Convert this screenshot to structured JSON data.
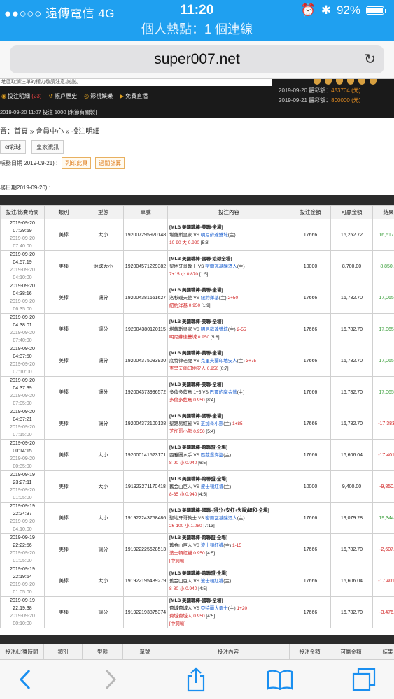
{
  "status": {
    "carrier": "●●○○○ 遠傳電信  4G",
    "time": "11:20",
    "battery": "92%",
    "hotspot": "個人熱點：1 個連線"
  },
  "browser": {
    "url": "super007.net"
  },
  "site": {
    "notice": "地區取消注單的權力敬請注意,謝謝。",
    "menu": [
      {
        "icon": "bet-list-icon",
        "label": "投注明細",
        "badge": "(23)"
      },
      {
        "icon": "history-icon",
        "label": "帳戶歷史"
      },
      {
        "icon": "video-icon",
        "label": "影視娛樂"
      },
      {
        "icon": "live-icon",
        "label": "免費直播"
      }
    ],
    "last_bet": "2019-09-20 11:07 投注 1000 [米節有關製]",
    "draws": [
      {
        "date": "2019-09-20",
        "label": "體彩額：",
        "amount": "453704 (元)"
      },
      {
        "date": "2019-09-21",
        "label": "體彩額：",
        "amount": "800000 (元)"
      }
    ],
    "breadcrumb": "置：首頁 » 會員中心 » 投注明細",
    "tabs": [
      "er彩球",
      "皇家視訊"
    ],
    "filter_label": "帳務日期  2019-09-21) :",
    "filter_buttons": [
      "列印此頁",
      "過關計算"
    ],
    "biz_date": "務日期2019-09-20) :"
  },
  "table": {
    "headers": [
      "投注/比賽時間",
      "類別",
      "型態",
      "單號",
      "投注內容",
      "投注金額",
      "可贏金額",
      "結果"
    ],
    "rows": [
      {
        "t1": "2019-09-20",
        "t2": "07:29:59",
        "t3": "2019-09-20",
        "t4": "07:40:00",
        "cat": "美棒",
        "type": "大小",
        "id": "192007295920148",
        "league": "[MLB 美國職棒-美聯-全場]",
        "home": "堪薩斯皇家",
        "vs": "VS",
        "away": "明尼蘇達雙城",
        "side": "(主)",
        "line": "",
        "pick": "10-90 大 0.920",
        "score": "[5:8]",
        "note": "",
        "amount": "17666",
        "win": "16,252.72",
        "result": "16,517.7",
        "res_class": "win"
      },
      {
        "t1": "2019-09-20",
        "t2": "04:57:19",
        "t3": "2019-09-20",
        "t4": "04:10:00",
        "cat": "美棒",
        "type": "滾球大小",
        "id": "192004571229382",
        "league": "[MLB 美國職棒-國聯-滾球全場]",
        "home": "聖地牙哥教士",
        "vs": "VS",
        "away": "密爾瓦基釀酒人",
        "side": "(主)",
        "line": "",
        "pick": "7+15 小 0.870",
        "score": "[1:5]",
        "note": "",
        "amount": "10000",
        "win": "8,700.00",
        "result": "8,850.0",
        "res_class": "win"
      },
      {
        "t1": "2019-09-20",
        "t2": "04:38:16",
        "t3": "2019-09-20",
        "t4": "06:35:00",
        "cat": "美棒",
        "type": "讓分",
        "id": "192004381651627",
        "league": "[MLB 美國職棒-美聯-全場]",
        "home": "洛杉磯天使",
        "vs": "VS",
        "away": "紐約洋基",
        "side": "(主)",
        "line": "2+50",
        "pick": "紐約洋基 0.950",
        "score": "[1:9]",
        "note": "",
        "amount": "17666",
        "win": "16,782.70",
        "result": "17,065.3",
        "res_class": "win"
      },
      {
        "t1": "2019-09-20",
        "t2": "04:38:01",
        "t3": "2019-09-20",
        "t4": "07:40:00",
        "cat": "美棒",
        "type": "讓分",
        "id": "192004380120115",
        "league": "[MLB 美國職棒-美聯-全場]",
        "home": "堪薩斯皇家",
        "vs": "VS",
        "away": "明尼蘇達雙城",
        "side": "(主)",
        "line": "2-55",
        "pick": "明尼蘇達雙城 0.950",
        "score": "[5:8]",
        "note": "",
        "amount": "17666",
        "win": "16,782.70",
        "result": "17,065.3",
        "res_class": "win"
      },
      {
        "t1": "2019-09-20",
        "t2": "04:37:50",
        "t3": "2019-09-20",
        "t4": "07:10:00",
        "cat": "美棒",
        "type": "讓分",
        "id": "192004375083930",
        "league": "[MLB 美國職棒-美聯-全場]",
        "home": "底特律老虎",
        "vs": "VS",
        "away": "克里夫蘭印地安人",
        "side": "(主)",
        "line": "3+75",
        "pick": "克里夫蘭印地安人 0.950",
        "score": "[0:7]",
        "note": "",
        "amount": "17666",
        "win": "16,782.70",
        "result": "17,065.3",
        "res_class": "win"
      },
      {
        "t1": "2019-09-20",
        "t2": "04:37:39",
        "t3": "2019-09-20",
        "t4": "07:05:00",
        "cat": "美棒",
        "type": "讓分",
        "id": "192004373996572",
        "league": "[MLB 美國職棒-美聯-全場]",
        "home": "多倫多藍鳥",
        "vs": "1+5 VS",
        "away": "巴爾的摩金鶯",
        "side": "(主)",
        "line": "",
        "pick": "多倫多藍鳥 0.950",
        "score": "[8:4]",
        "note": "",
        "amount": "17666",
        "win": "16,782.70",
        "result": "17,065.3",
        "res_class": "win"
      },
      {
        "t1": "2019-09-20",
        "t2": "04:37:21",
        "t3": "2019-09-20",
        "t4": "07:15:00",
        "cat": "美棒",
        "type": "讓分",
        "id": "192004372100138",
        "league": "[MLB 美國職棒-國聯-全場]",
        "home": "聖路易紅雀",
        "vs": "VS",
        "away": "芝加哥小熊",
        "side": "(主)",
        "line": "1+85",
        "pick": "芝加哥小熊 0.950",
        "score": "[5:4]",
        "note": "",
        "amount": "17666",
        "win": "16,782.70",
        "result": "-17,383.3",
        "res_class": "lose"
      },
      {
        "t1": "2019-09-20",
        "t2": "00:14:15",
        "t3": "2019-09-20",
        "t4": "00:35:00",
        "cat": "美棒",
        "type": "大小",
        "id": "192000141523171",
        "league": "[MLB 美國職棒-跨聯盟-全場]",
        "home": "西雅圖水手",
        "vs": "VS",
        "away": "匹茲堡海盜",
        "side": "(主)",
        "line": "",
        "pick": "8-90 小 0.940",
        "score": "[6:5]",
        "note": "",
        "amount": "17666",
        "win": "16,606.04",
        "result": "-17,401.0",
        "res_class": "lose"
      },
      {
        "t1": "2019-09-19",
        "t2": "23:27:11",
        "t3": "2019-09-20",
        "t4": "01:05:00",
        "cat": "美棒",
        "type": "大小",
        "id": "191923271170418",
        "league": "[MLB 美國職棒-跨聯盟-全場]",
        "home": "舊金山巨人",
        "vs": "VS",
        "away": "波士頓紅襪",
        "side": "(主)",
        "line": "",
        "pick": "8-35 小 0.940",
        "score": "[4:5]",
        "note": "",
        "amount": "10000",
        "win": "9,400.00",
        "result": "-9,850.0",
        "res_class": "lose"
      },
      {
        "t1": "2019-09-19",
        "t2": "22:24:37",
        "t3": "2019-09-20",
        "t4": "04:10:00",
        "cat": "美棒",
        "type": "大小",
        "id": "191922243758486",
        "league": "[MLB 美國職棒-國聯-(得分+安打+失誤)總和-全場]",
        "home": "聖地牙哥教士",
        "vs": "VS",
        "away": "密爾瓦基釀酒人",
        "side": "(主)",
        "line": "",
        "pick": "26-100 小 1.080",
        "score": "[7:13]",
        "note": "",
        "amount": "17666",
        "win": "19,079.28",
        "result": "19,344.2",
        "res_class": "win"
      },
      {
        "t1": "2019-09-19",
        "t2": "22:22:56",
        "t3": "2019-09-20",
        "t4": "01:05:00",
        "cat": "美棒",
        "type": "讓分",
        "id": "191922225628513",
        "league": "[MLB 美國職棒-跨聯盟-全場]",
        "home": "舊金山巨人",
        "vs": "VS",
        "away": "波士頓紅襪",
        "side": "(主)",
        "line": "1-15",
        "pick": "波士頓紅襪 0.950",
        "score": "[4:5]",
        "note": "[中洞輸]",
        "amount": "17666",
        "win": "16,782.70",
        "result": "-2,607.5",
        "res_class": "lose"
      },
      {
        "t1": "2019-09-19",
        "t2": "22:19:54",
        "t3": "2019-09-20",
        "t4": "01:05:00",
        "cat": "美棒",
        "type": "大小",
        "id": "191922195439279",
        "league": "[MLB 美國職棒-跨聯盟-全場]",
        "home": "舊金山巨人",
        "vs": "VS",
        "away": "波士頓紅襪",
        "side": "(主)",
        "line": "",
        "pick": "8-80 小 0.940",
        "score": "[4:5]",
        "note": "",
        "amount": "17666",
        "win": "16,606.04",
        "result": "-17,401.0",
        "res_class": "lose"
      },
      {
        "t1": "2019-09-19",
        "t2": "22:19:38",
        "t3": "2019-09-20",
        "t4": "00:10:00",
        "cat": "美棒",
        "type": "讓分",
        "id": "191922193875374",
        "league": "[MLB 美國職棒-國聯-全場]",
        "home": "費城費城人",
        "vs": "VS",
        "away": "亞特蘭大勇士",
        "side": "(主)",
        "line": "1+20",
        "pick": "費城費城人 0.950",
        "score": "[4:5]",
        "note": "[中洞輸]",
        "amount": "17666",
        "win": "16,782.70",
        "result": "-3,476.6",
        "res_class": "lose"
      }
    ]
  },
  "toolbar": {
    "back": "back-icon",
    "forward": "forward-icon",
    "share": "share-icon",
    "bookmarks": "bookmarks-icon",
    "tabs": "tabs-icon"
  }
}
